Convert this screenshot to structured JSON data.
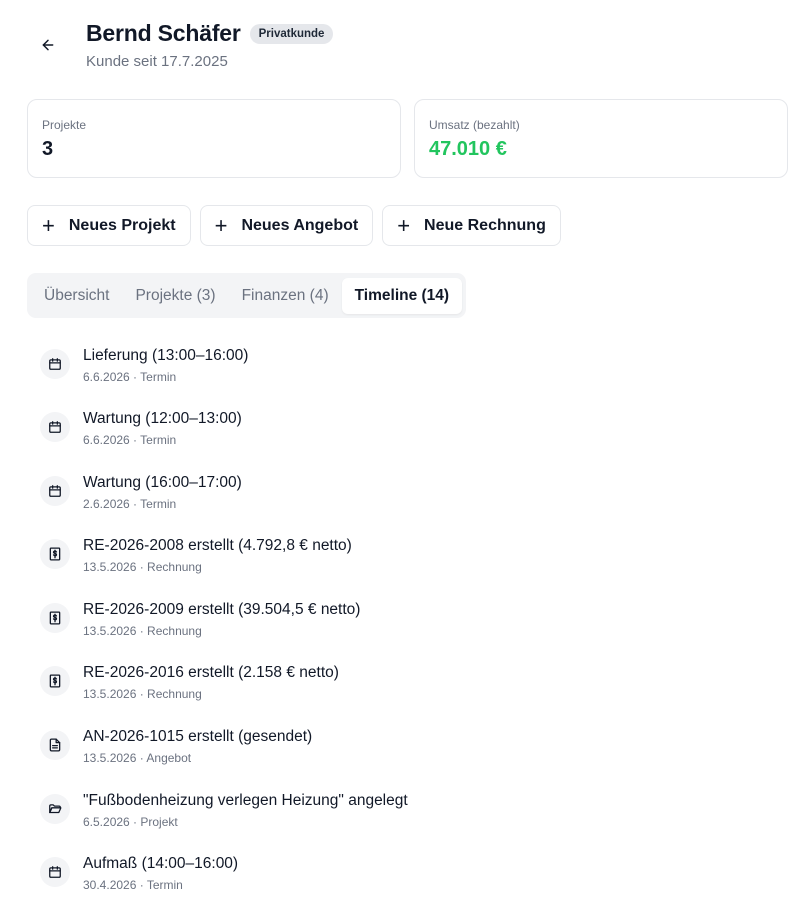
{
  "header": {
    "name": "Bernd Schäfer",
    "badge": "Privatkunde",
    "subtitle": "Kunde seit 17.7.2025"
  },
  "stats": {
    "projects_label": "Projekte",
    "projects_value": "3",
    "revenue_label": "Umsatz (bezahlt)",
    "revenue_value": "47.010 €",
    "revenue_color": "#22c55e"
  },
  "actions": {
    "new_project": "Neues Projekt",
    "new_offer": "Neues Angebot",
    "new_invoice": "Neue Rechnung"
  },
  "tabs": [
    {
      "label": "Übersicht",
      "active": false
    },
    {
      "label": "Projekte (3)",
      "active": false
    },
    {
      "label": "Finanzen (4)",
      "active": false
    },
    {
      "label": "Timeline (14)",
      "active": true
    }
  ],
  "timeline": [
    {
      "icon": "calendar-icon",
      "title": "Lieferung (13:00–16:00)",
      "meta": "6.6.2026 · Termin"
    },
    {
      "icon": "calendar-icon",
      "title": "Wartung (12:00–13:00)",
      "meta": "6.6.2026 · Termin"
    },
    {
      "icon": "calendar-icon",
      "title": "Wartung (16:00–17:00)",
      "meta": "2.6.2026 · Termin"
    },
    {
      "icon": "invoice-icon",
      "title": "RE-2026-2008 erstellt (4.792,8 € netto)",
      "meta": "13.5.2026 · Rechnung"
    },
    {
      "icon": "invoice-icon",
      "title": "RE-2026-2009 erstellt (39.504,5 € netto)",
      "meta": "13.5.2026 · Rechnung"
    },
    {
      "icon": "invoice-icon",
      "title": "RE-2026-2016 erstellt (2.158 € netto)",
      "meta": "13.5.2026 · Rechnung"
    },
    {
      "icon": "document-icon",
      "title": "AN-2026-1015 erstellt (gesendet)",
      "meta": "13.5.2026 · Angebot"
    },
    {
      "icon": "folder-icon",
      "title": "\"Fußbodenheizung verlegen Heizung\" angelegt",
      "meta": "6.5.2026 · Projekt"
    },
    {
      "icon": "calendar-icon",
      "title": "Aufmaß (14:00–16:00)",
      "meta": "30.4.2026 · Termin"
    }
  ]
}
